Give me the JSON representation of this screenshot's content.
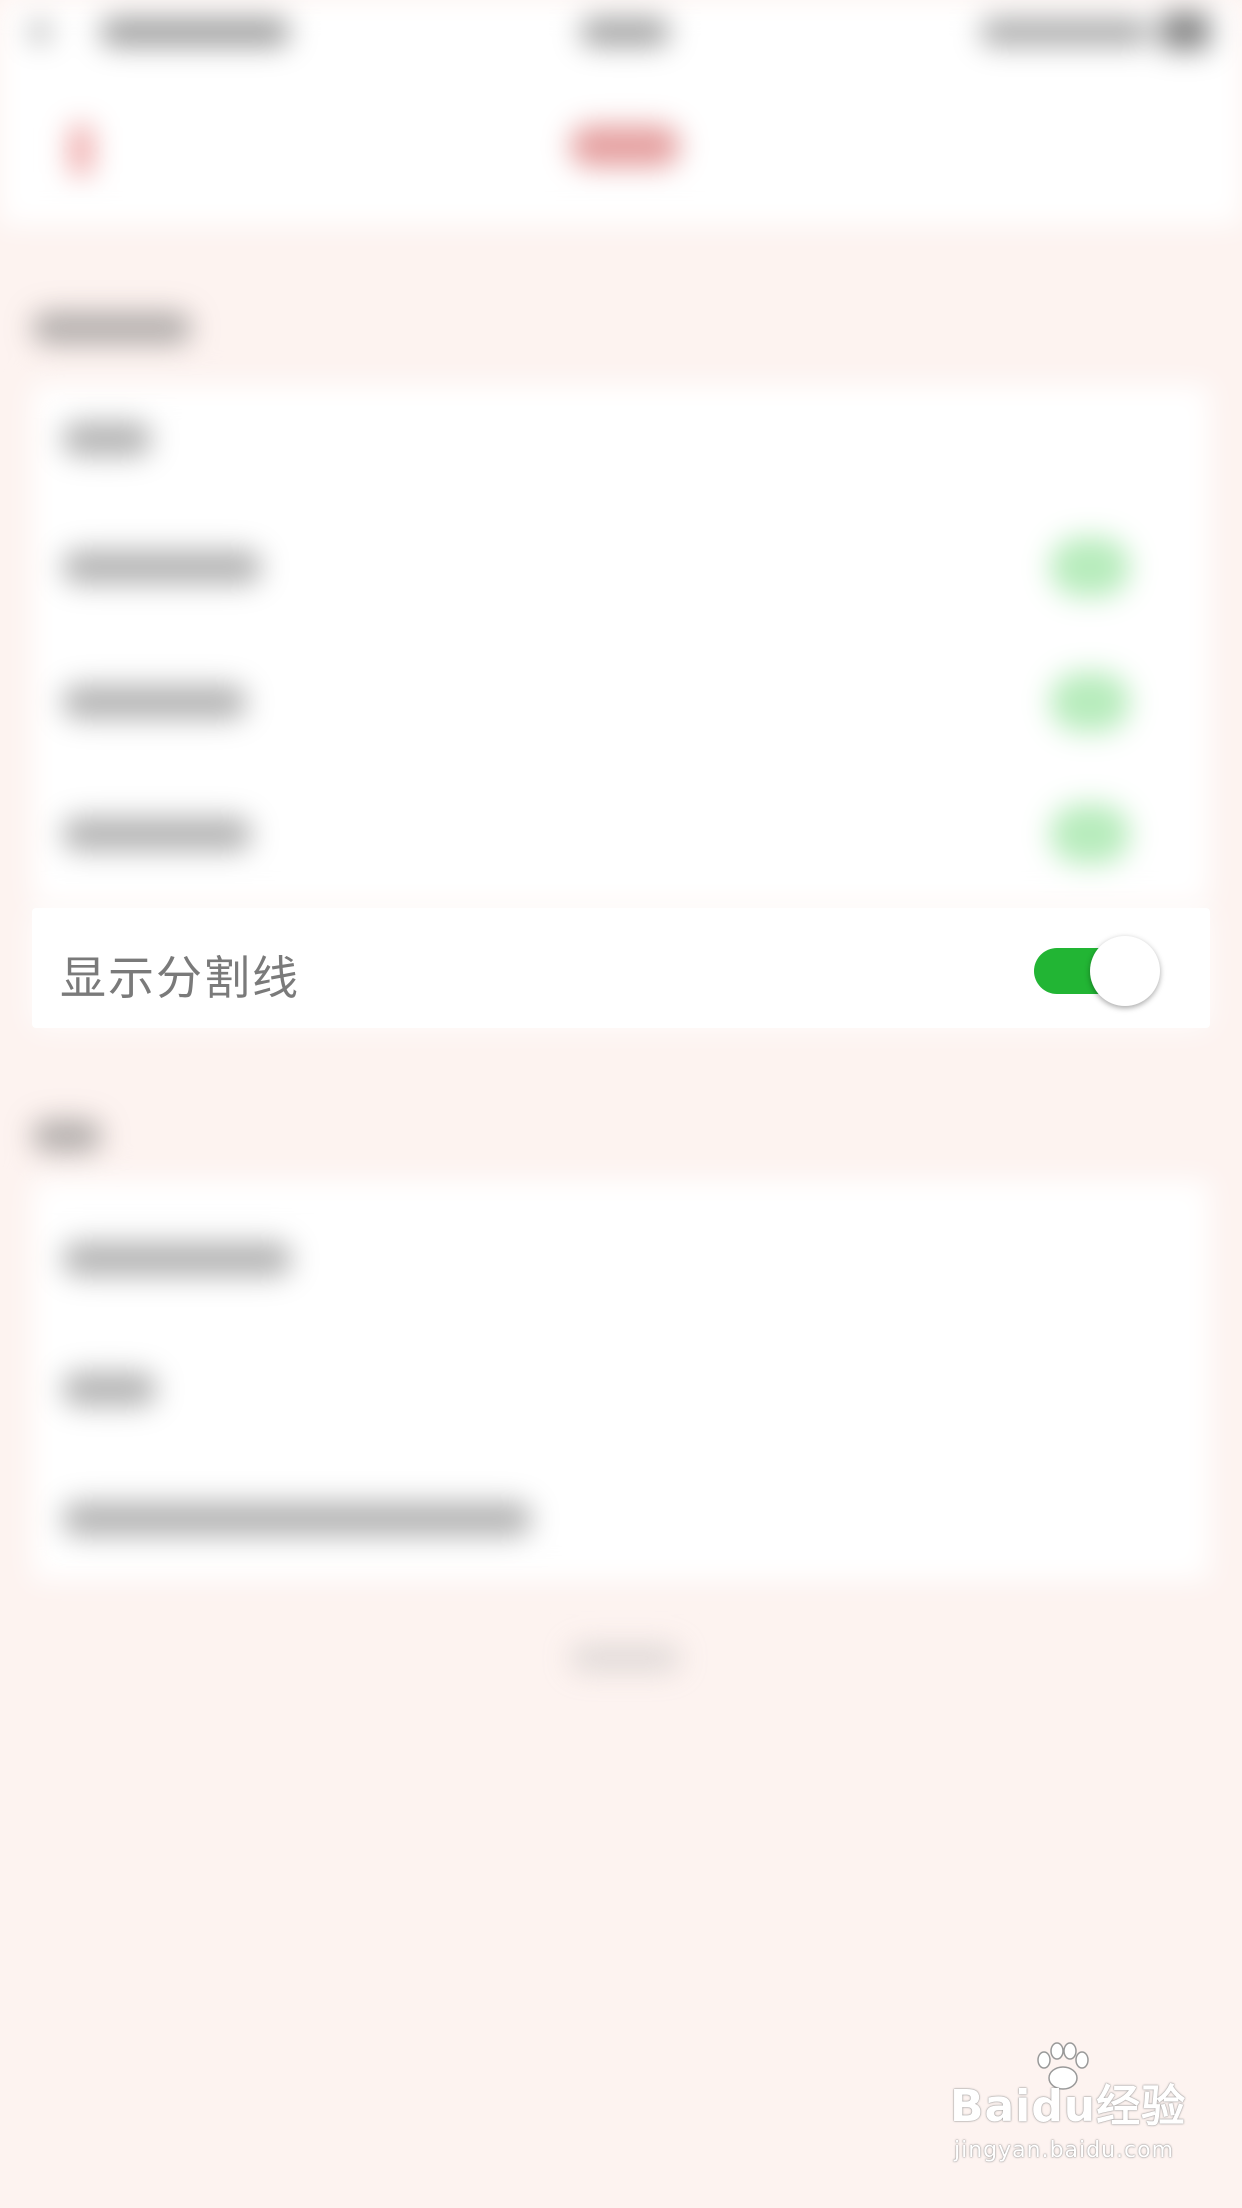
{
  "focused_row": {
    "label": "显示分割线",
    "toggle_on": true
  },
  "colors": {
    "toggle_on": "#22b534",
    "background": "#fdf3f0",
    "accent": "#e05a5a"
  },
  "watermark": {
    "brand": "Baidu经验",
    "url": "jingyan.baidu.com"
  }
}
